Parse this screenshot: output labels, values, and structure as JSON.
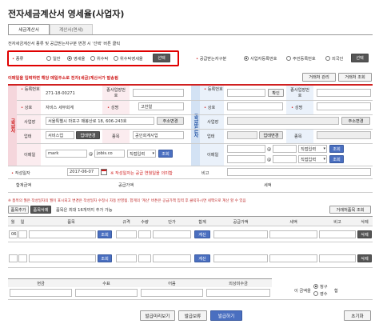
{
  "page": {
    "title": "전자세금계산서 영세율(사업자)"
  },
  "tabs": [
    {
      "label": "세금계산서"
    },
    {
      "label": "계산서(면세)"
    }
  ],
  "notice": {
    "text": "전자세금계산서 종류 및 공급받는자구분 변경 시 '선택' 버튼 클릭"
  },
  "type_select": {
    "label": "종류",
    "options": [
      "일반",
      "영세율",
      "위수탁",
      "위수탁영세율"
    ],
    "selected": 1,
    "select_button": "선택"
  },
  "receiver_type": {
    "label": "공급받는자구분",
    "options": [
      "사업자등록번호",
      "주민등록번호",
      "외국인"
    ],
    "selected": 0,
    "select_button": "선택"
  },
  "email_notice": {
    "text": "이메일을 입력하면 해당 메일주소로 전자(세금)계산서가 발송됨"
  },
  "top_buttons": {
    "partner_manage": "거래처 관리",
    "partner_search": "거래처 조회"
  },
  "supplier": {
    "side_label": "공급자",
    "reg_no_label": "등록번호",
    "reg_no_value": "271-18-00271",
    "branch_label": "종사업장번호",
    "company_label": "상호",
    "company_value": "자비스 세무회계",
    "name_label": "성명",
    "name_value": "고한얼",
    "address_label": "사업장",
    "address_value": "서울특별시 마포구 매봉산로 18, 606-243호",
    "address_button": "주소변경",
    "biz_type_label": "업태",
    "biz_type_value": "서비스업",
    "biz_type_button": "업태변경",
    "item_label": "종목",
    "item_value": "공인회계사업",
    "email_label": "이메일",
    "email_id": "mark",
    "email_at": "@",
    "email_domain": "jobis.co",
    "email_select": "직접입력",
    "email_button": "조회"
  },
  "receiver": {
    "side_label": "공급받는자",
    "reg_no_label": "등록번호",
    "confirm_button": "확인",
    "branch_label": "종사업장번호",
    "company_label": "상호",
    "name_label": "성명",
    "address_label": "사업장",
    "address_button": "주소변경",
    "biz_type_label": "업태",
    "biz_type_button": "업태변경",
    "item_label": "종목",
    "email_label": "이메일",
    "email_at": "@",
    "email_select": "직접입력",
    "email_button": "조회",
    "email2_at": "@",
    "email2_select": "직접입력",
    "email2_button": "조회"
  },
  "write_date": {
    "label": "작성일자",
    "value": "2017-06-07",
    "hint": "※ 작성일자는 공급 연월일을 의미함",
    "note_label": "비고"
  },
  "totals_row": {
    "supply_label": "합계금액",
    "supply_total_label": "공급가액",
    "tax_label": "세액"
  },
  "items_notice": {
    "text": "※ 품목의 월은 작성일자의 월이 표시되고 변경은 작성일자 수정시 자동 반영됨. 합계의 '계산' 버튼은 공급가액 입력 후 클릭하시면 세액으로 계산 할 수 있음"
  },
  "items_controls": {
    "add_button": "품목추가",
    "delete_button": "품목삭제",
    "max_note": "품목은 최대 16개까지 추가 가능",
    "partner_item_button": "거래처품목 조회"
  },
  "items_table": {
    "headers": [
      "월",
      "일",
      "품목",
      "규격",
      "수량",
      "단가",
      "합계",
      "공급가액",
      "세액",
      "비고",
      "삭제"
    ],
    "rows": [
      {
        "month": "06",
        "search": "조회",
        "calc": "계산",
        "delete": "삭제"
      }
    ],
    "summary": {
      "calc": "계산",
      "delete": "삭제"
    }
  },
  "payment": {
    "headers": [
      "현금",
      "수표",
      "어음",
      "외상미수금"
    ],
    "amount_label": "이 금액을",
    "receipt_options": [
      "청구",
      "영수"
    ],
    "selected": 0,
    "suffix": "함"
  },
  "bottom_buttons": {
    "preview": "발급미리보기",
    "save": "발급보류",
    "issue": "발급하기",
    "reset": "초기화"
  },
  "colors": {
    "accent_red": "#d02020",
    "supplier_pink": "#f5d6dc",
    "receiver_blue": "#d3e2f4",
    "issue_blue": "#4a6fc0"
  }
}
